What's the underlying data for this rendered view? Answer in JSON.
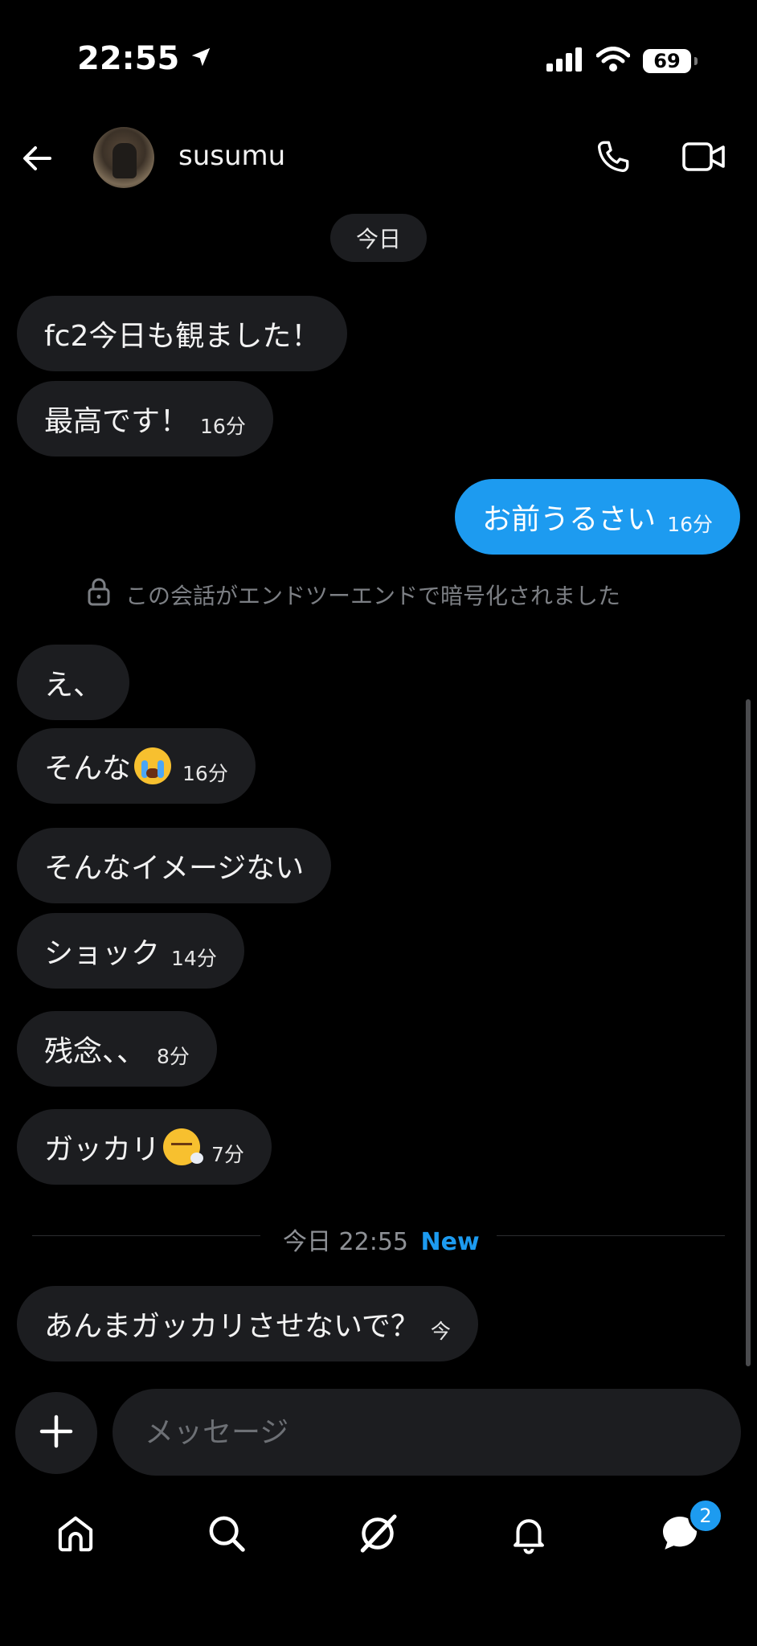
{
  "status_bar": {
    "time": "22:55",
    "battery": "69"
  },
  "header": {
    "contact_name": "susumu"
  },
  "date_pill": "今日",
  "messages": [
    {
      "text": "fc2今日も観ました！",
      "time": ""
    },
    {
      "text": "最高です！",
      "time": "16分"
    },
    {
      "text": "お前うるさい",
      "time": "16分"
    },
    {
      "text": "え、",
      "time": ""
    },
    {
      "text": "そんな",
      "time": "16分",
      "emoji": "loudly-crying-face"
    },
    {
      "text": "そんなイメージない",
      "time": ""
    },
    {
      "text": "ショック",
      "time": "14分"
    },
    {
      "text": "残念、、",
      "time": "8分"
    },
    {
      "text": "ガッカリ",
      "time": "7分",
      "emoji": "face-exhaling"
    },
    {
      "text": "あんまガッカリさせないで？",
      "time": "今"
    }
  ],
  "encryption_notice": "この会話がエンドツーエンドで暗号化されました",
  "new_divider": {
    "label": "今日 22:55",
    "new": "New"
  },
  "composer": {
    "placeholder": "メッセージ"
  },
  "tabbar": {
    "messages_badge": "2"
  },
  "colors": {
    "accent": "#1d9bf0",
    "bubble": "#1c1d20",
    "background": "#000000"
  }
}
